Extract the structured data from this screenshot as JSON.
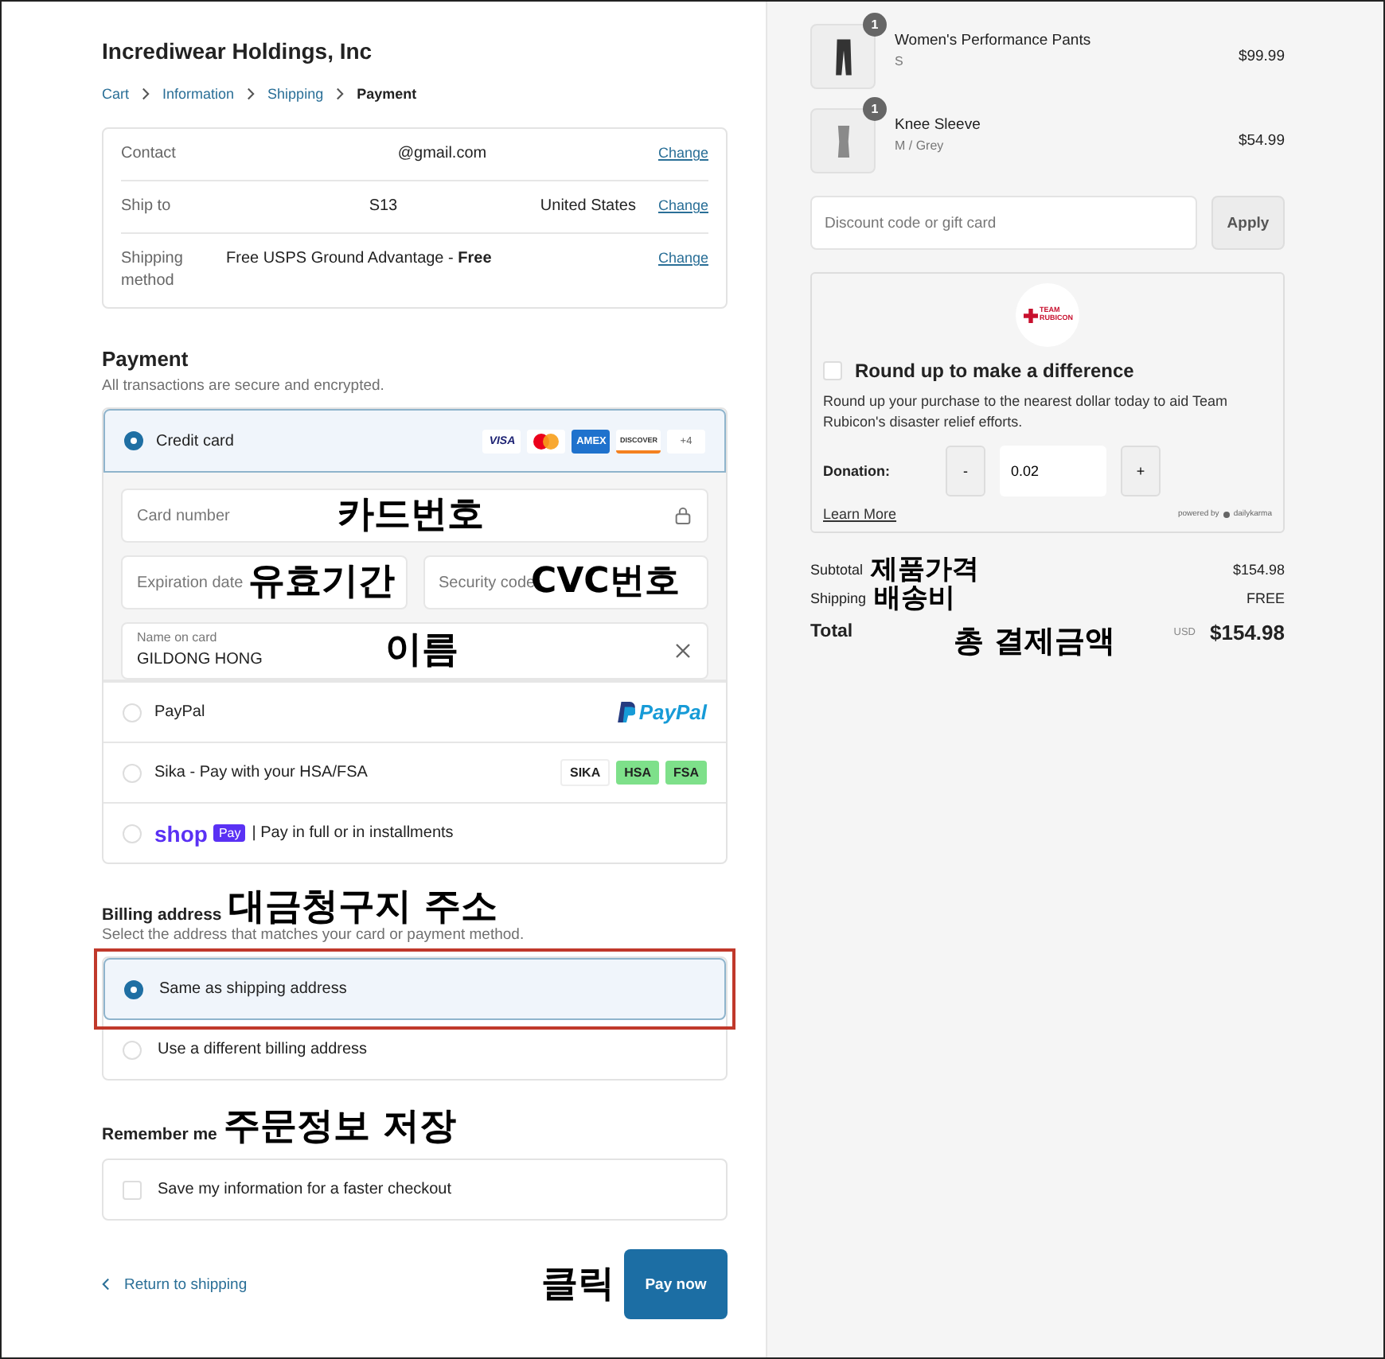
{
  "store_name": "Incrediwear Holdings, Inc",
  "breadcrumb": [
    {
      "label": "Cart",
      "selected": false
    },
    {
      "label": "Information",
      "selected": false
    },
    {
      "label": "Shipping",
      "selected": false
    },
    {
      "label": "Payment",
      "selected": true
    }
  ],
  "review": [
    {
      "label": "Contact",
      "value": "@gmail.com",
      "link": "Change"
    },
    {
      "label": "Ship to",
      "value": "S13",
      "extra": "United States",
      "link": "Change"
    },
    {
      "label": "Shipping method",
      "value": "Free USPS Ground Advantage - **Free**",
      "link": "Change"
    }
  ],
  "payment": {
    "title": "Payment",
    "subtitle": "All transactions are secure and encrypted.",
    "methods": [
      {
        "kind": "card",
        "label": "Credit card",
        "selected": true,
        "brands": [
          {
            "kind": "visa",
            "text": "VISA"
          },
          {
            "kind": "mastercard"
          },
          {
            "kind": "amex",
            "text": "AMEX"
          },
          {
            "kind": "discover",
            "text": "DISCOVER"
          },
          {
            "kind": "more",
            "text": "+4"
          }
        ],
        "fields": [
          {
            "kind": "card_number",
            "placeholder": "Card number",
            "annotation": "카드번호"
          },
          {
            "kind": "expiry",
            "placeholder": "Expiration date",
            "annotation": "유효기간"
          },
          {
            "kind": "security",
            "placeholder": "Security code",
            "annotation": "CVC번호"
          },
          {
            "kind": "name",
            "label": "Name on card",
            "value": "GILDONG HONG",
            "annotation": "이름"
          }
        ]
      },
      {
        "kind": "paypal",
        "label": "PayPal",
        "selected": false,
        "logo": "PayPal"
      },
      {
        "kind": "sika",
        "label": "Sika - Pay with your HSA/FSA",
        "selected": false,
        "badges": [
          "SIKA",
          "HSA",
          "FSA"
        ]
      },
      {
        "kind": "shop",
        "label": "| Pay in full or in installments",
        "selected": false,
        "logo": "shop",
        "logo_badge": "Pay"
      }
    ]
  },
  "billing": {
    "title": "Billing address",
    "annotation": "대금청구지 주소",
    "subtitle": "Select the address that matches your card or payment method.",
    "options": [
      {
        "label": "Same as shipping address",
        "selected": true,
        "highlighted": true
      },
      {
        "label": "Use a different billing address",
        "selected": false,
        "highlighted": false
      }
    ]
  },
  "remember": {
    "title": "Remember me",
    "annotation": "주문정보 저장",
    "checkbox": {
      "label": "Save my information for a faster checkout",
      "checked": false
    }
  },
  "footer": {
    "back_link": "Return to shipping",
    "annotation": "클릭",
    "pay_button": "Pay now"
  },
  "items": [
    {
      "kind": "pants",
      "quantity": "1",
      "name": "Women's Performance Pants",
      "variant": "S",
      "price": "$99.99"
    },
    {
      "kind": "sleeve",
      "quantity": "1",
      "name": "Knee Sleeve",
      "variant": "M / Grey",
      "price": "$54.99"
    }
  ],
  "discount": {
    "placeholder": "Discount code or gift card",
    "button": "Apply"
  },
  "donation": {
    "logo": "TEAM RUBICON",
    "checked": false,
    "title": "Round up to make a difference",
    "description": "Round up your purchase to the nearest dollar today to aid Team Rubicon's disaster relief efforts.",
    "label": "Donation:",
    "minus": "-",
    "value": "0.02",
    "plus": "+",
    "learn_more": "Learn More",
    "powered_by": "powered by",
    "provider": "dailykarma"
  },
  "totals": [
    {
      "kind": "subtotal",
      "label": "Subtotal",
      "annotation": "제품가격",
      "value": "$154.98"
    },
    {
      "kind": "shipping",
      "label": "Shipping",
      "annotation": "배송비",
      "value": "FREE"
    },
    {
      "kind": "total",
      "label": "Total",
      "annotation": "총 결제금액",
      "currency": "USD",
      "value": "$154.98"
    }
  ]
}
